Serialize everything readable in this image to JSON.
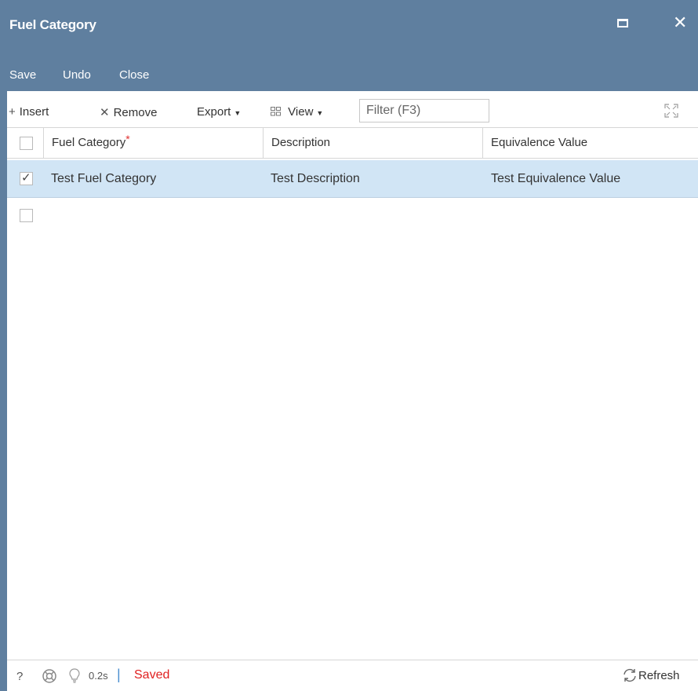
{
  "window": {
    "title": "Fuel Category",
    "colors": {
      "titlebar": "#5f7f9f",
      "row_selected": "#d1e5f5",
      "saved_status": "#e02020"
    }
  },
  "menu": {
    "save": "Save",
    "undo": "Undo",
    "close": "Close"
  },
  "toolbar": {
    "insert": "Insert",
    "remove": "Remove",
    "export": "Export",
    "view": "View",
    "filter_placeholder": "Filter (F3)"
  },
  "grid": {
    "columns": [
      "Fuel Category",
      "Description",
      "Equivalence Value"
    ],
    "required_marker": "*",
    "rows": [
      {
        "checked": true,
        "fuel_category": "Test Fuel Category",
        "description": "Test Description",
        "equivalence_value": "Test Equivalence Value"
      },
      {
        "checked": false,
        "fuel_category": "",
        "description": "",
        "equivalence_value": ""
      }
    ]
  },
  "status": {
    "help": "?",
    "time": "0.2s",
    "separator": "|",
    "message": "Saved",
    "refresh": "Refresh"
  }
}
